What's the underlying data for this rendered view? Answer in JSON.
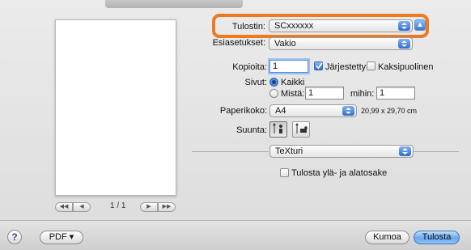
{
  "printer": {
    "label": "Tulostin:",
    "value": "SCxxxxxx"
  },
  "presets": {
    "label": "Esiasetukset:",
    "value": "Vakio"
  },
  "copies": {
    "label": "Kopioita:",
    "value": "1",
    "collated_label": "Järjestetty",
    "collated": true,
    "two_sided_label": "Kaksipuolinen",
    "two_sided": false
  },
  "pages": {
    "label": "Sivut:",
    "all_label": "Kaikki",
    "from_label": "Mistä:",
    "from_value": "1",
    "to_label": "mihin:",
    "to_value": "1",
    "selected": "all"
  },
  "paper": {
    "label": "Paperikoko:",
    "value": "A4",
    "dimensions": "20,99 x 29,70 cm"
  },
  "orientation": {
    "label": "Suunta:",
    "selected": "portrait"
  },
  "section": {
    "value": "TeXturi"
  },
  "header_footer": {
    "label": "Tulosta ylä- ja alatosake",
    "checked": false
  },
  "preview": {
    "page_count": "1 / 1"
  },
  "footer": {
    "help": "?",
    "pdf_label": "PDF ▾",
    "cancel_label": "Kumoa",
    "print_label": "Tulosta"
  },
  "colors": {
    "highlight": "#ef7a1e",
    "accent": "#2f6fd0"
  }
}
